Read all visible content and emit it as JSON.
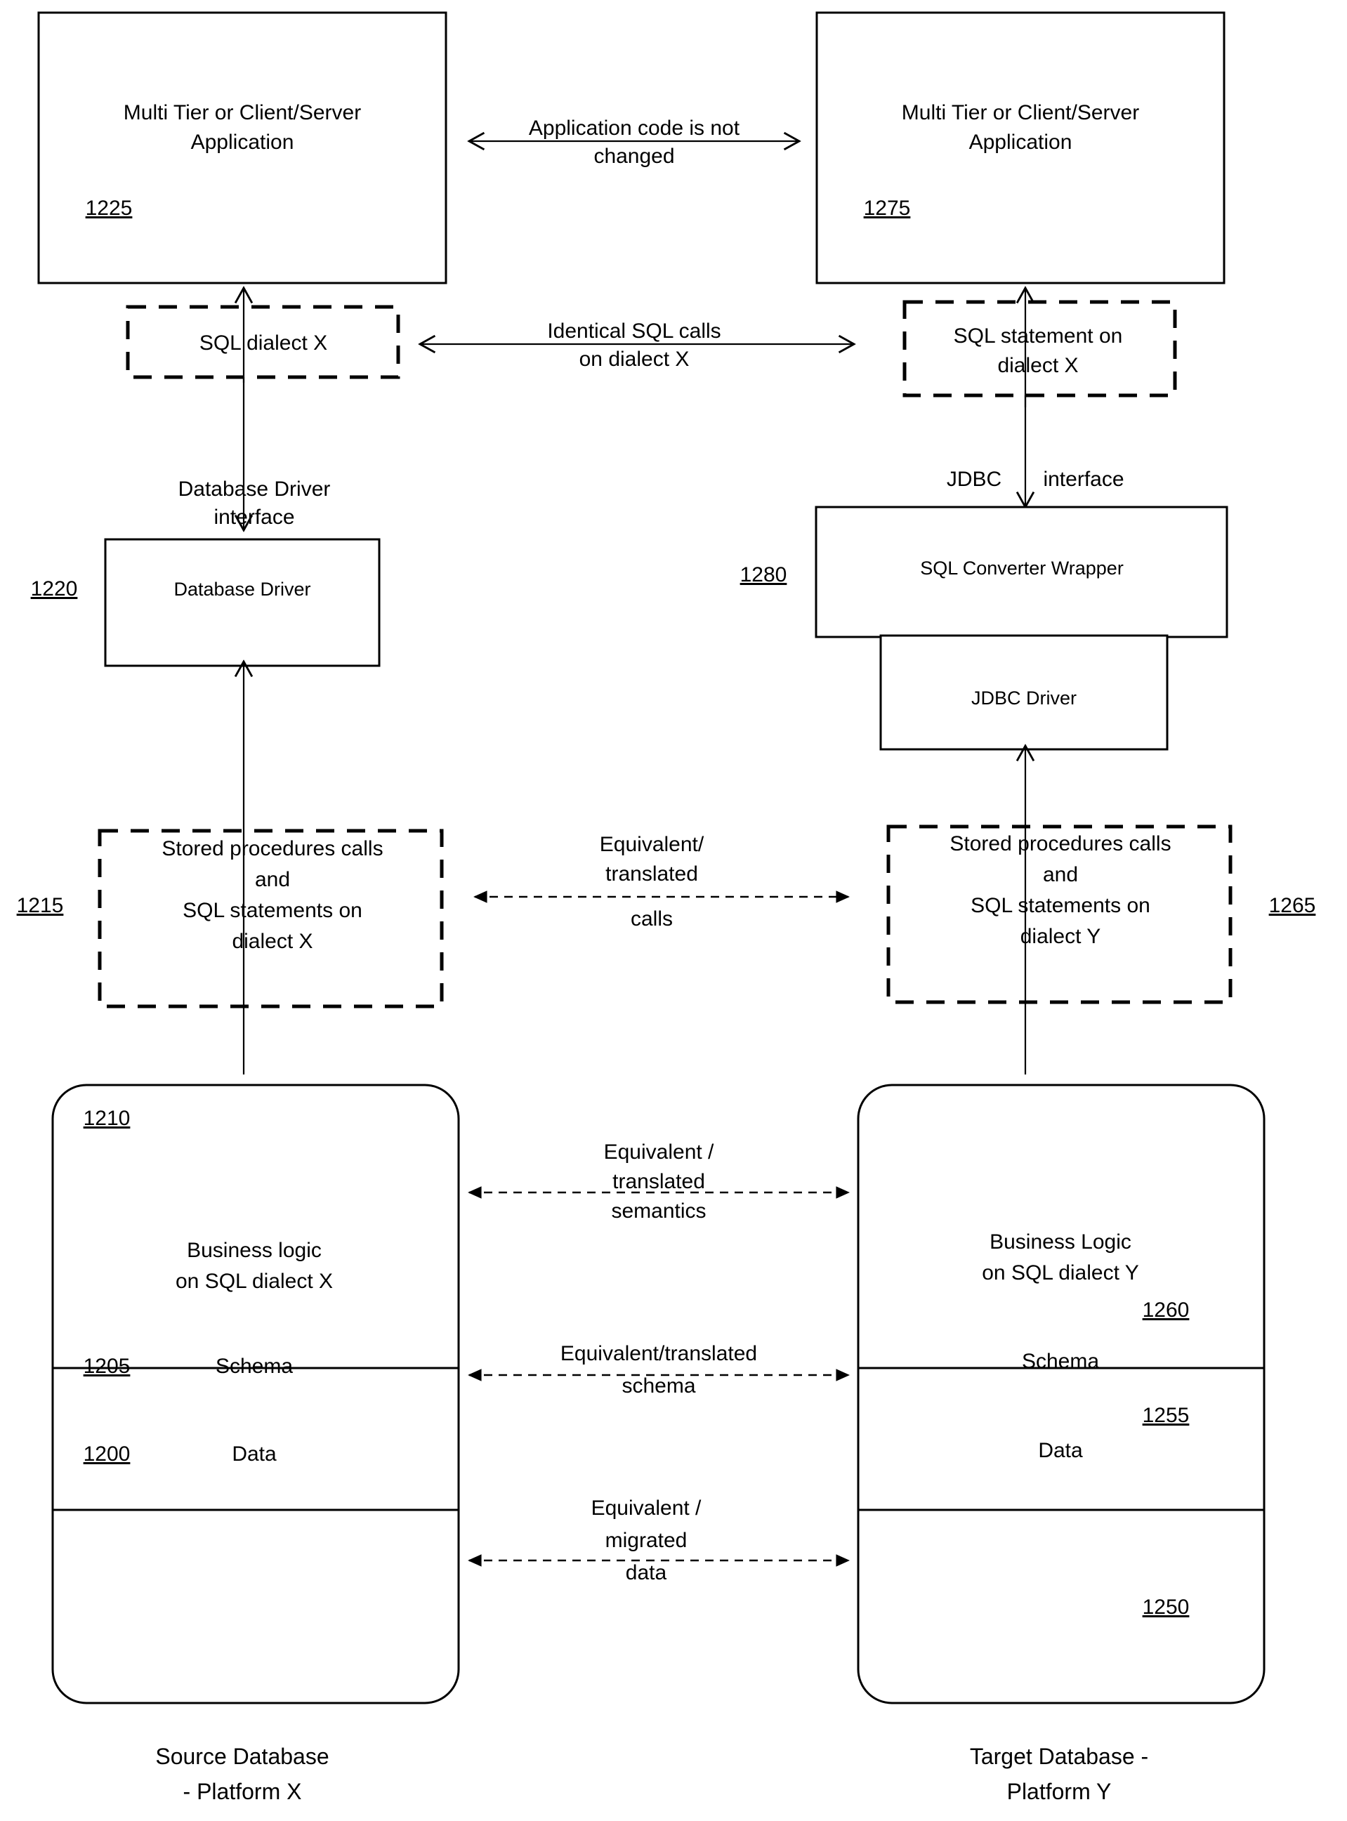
{
  "figure": {
    "type": "patent-block-diagram",
    "background_color": "#ffffff",
    "line_color": "#000000"
  },
  "left_column": {
    "application": {
      "label_line1": "Multi Tier or Client/Server",
      "label_line2": "Application",
      "ref": "1225"
    },
    "sql_dialect": {
      "label_line1": "SQL dialect X",
      "label_line2": ""
    },
    "driver_interface_label_line1": "Database Driver",
    "driver_interface_label_line2": "interface",
    "driver": {
      "label": "Database Driver",
      "ref": "1220"
    },
    "stored_procedures": {
      "line1": "Stored procedures calls",
      "line2": "and",
      "line3": "SQL statements on",
      "line4": "dialect X",
      "ref": "1215"
    },
    "database": {
      "business_logic_line1": "Business logic",
      "business_logic_line2": "on SQL dialect X",
      "business_logic_ref": "1210",
      "schema_label": "Schema",
      "schema_ref": "1205",
      "data_label": "Data",
      "data_ref": "1200"
    },
    "caption_line1": "Source Database",
    "caption_line2": "- Platform X"
  },
  "right_column": {
    "application": {
      "label_line1": "Multi Tier or Client/Server",
      "label_line2": "Application",
      "ref": "1275"
    },
    "sql_statement": {
      "label_line1": "SQL statement on",
      "label_line2": "dialect X"
    },
    "jdbc_interface_label_left": "JDBC",
    "jdbc_interface_label_right": "interface",
    "converter": {
      "label": "SQL Converter Wrapper",
      "ref": "1280"
    },
    "jdbc_driver": {
      "label": "JDBC Driver"
    },
    "stored_procedures": {
      "line1": "Stored procedures calls",
      "line2": "and",
      "line3": "SQL statements on",
      "line4": "dialect Y",
      "ref": "1265"
    },
    "database": {
      "business_logic_line1": "Business Logic",
      "business_logic_line2": "on SQL dialect Y",
      "business_logic_ref": "1260",
      "schema_label": "Schema",
      "schema_ref": "1255",
      "data_label": "Data",
      "data_ref": "1250"
    },
    "caption_line1": "Target Database -",
    "caption_line2": "Platform Y"
  },
  "cross_arrows": {
    "app": {
      "line1": "Application code is not",
      "line2": "changed",
      "style": "solid",
      "direction": "both"
    },
    "sql_calls": {
      "line1": "Identical SQL calls",
      "line2": "on dialect X",
      "style": "solid",
      "direction": "both"
    },
    "translated_calls": {
      "line1": "Equivalent/",
      "line2": "translated",
      "line3": "calls",
      "style": "dashed",
      "direction": "both"
    },
    "semantics": {
      "line1": "Equivalent /",
      "line2": "translated",
      "line3": "semantics",
      "style": "dashed",
      "direction": "both"
    },
    "schema": {
      "line1": "Equivalent/translated",
      "line2": "schema",
      "style": "dashed",
      "direction": "both"
    },
    "data": {
      "line1": "Equivalent /",
      "line2": "migrated",
      "line3": "data",
      "style": "dashed",
      "direction": "both"
    }
  }
}
